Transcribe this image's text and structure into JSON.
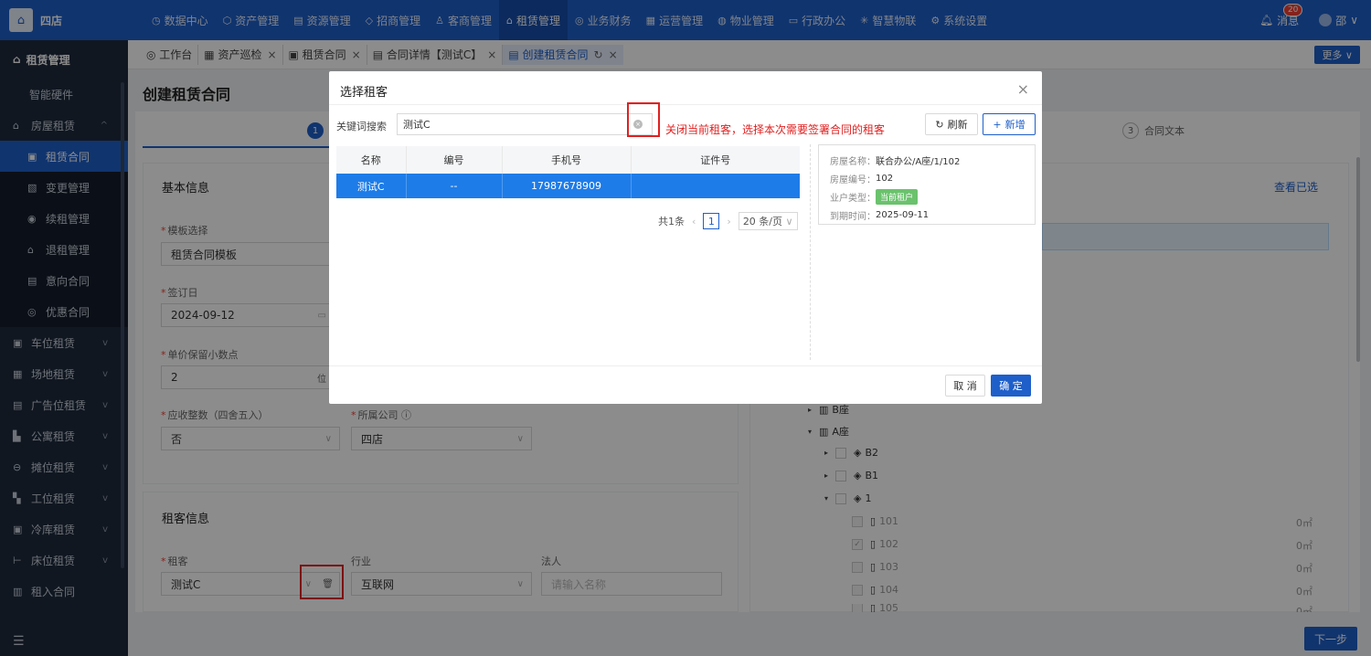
{
  "app": {
    "logo_glyph": "⌂",
    "brand": "四店"
  },
  "nav": [
    {
      "icon": "◷",
      "label": "数据中心"
    },
    {
      "icon": "⬡",
      "label": "资产管理"
    },
    {
      "icon": "▤",
      "label": "资源管理"
    },
    {
      "icon": "◇",
      "label": "招商管理"
    },
    {
      "icon": "♙",
      "label": "客商管理"
    },
    {
      "icon": "⌂",
      "label": "租赁管理"
    },
    {
      "icon": "◎",
      "label": "业务财务"
    },
    {
      "icon": "▦",
      "label": "运营管理"
    },
    {
      "icon": "◍",
      "label": "物业管理"
    },
    {
      "icon": "▭",
      "label": "行政办公"
    },
    {
      "icon": "✳",
      "label": "智慧物联"
    },
    {
      "icon": "⚙",
      "label": "系统设置"
    }
  ],
  "top_right": {
    "msg_label": "消息",
    "msg_count": "20",
    "user_label": "邵"
  },
  "sidebar": {
    "title": "租赁管理",
    "items": [
      {
        "label": "智能硬件",
        "icon": ""
      },
      {
        "label": "房屋租赁",
        "icon": "⌂",
        "chev": "^"
      },
      {
        "label": "租赁合同",
        "icon": "▣"
      },
      {
        "label": "变更管理",
        "icon": "▧"
      },
      {
        "label": "续租管理",
        "icon": "◉"
      },
      {
        "label": "退租管理",
        "icon": "⌂"
      },
      {
        "label": "意向合同",
        "icon": "▤"
      },
      {
        "label": "优惠合同",
        "icon": "◎"
      },
      {
        "label": "车位租赁",
        "icon": "▣",
        "chev": "v"
      },
      {
        "label": "场地租赁",
        "icon": "▦",
        "chev": "v"
      },
      {
        "label": "广告位租赁",
        "icon": "▤",
        "chev": "v"
      },
      {
        "label": "公寓租赁",
        "icon": "▙",
        "chev": "v"
      },
      {
        "label": "摊位租赁",
        "icon": "⊖",
        "chev": "v"
      },
      {
        "label": "工位租赁",
        "icon": "▚",
        "chev": "v"
      },
      {
        "label": "冷库租赁",
        "icon": "▣",
        "chev": "v"
      },
      {
        "label": "床位租赁",
        "icon": "⊢",
        "chev": "v"
      },
      {
        "label": "租入合同",
        "icon": "▥"
      }
    ],
    "foot_icon": "☰"
  },
  "tabs": [
    {
      "label": "◎ 工作台",
      "closable": false
    },
    {
      "label": "▦ 资产巡检",
      "closable": true
    },
    {
      "label": "▣ 租赁合同",
      "closable": true
    },
    {
      "label": "▤ 合同详情【测试C】",
      "closable": true
    },
    {
      "label": "▤ 创建租赁合同",
      "closable": true,
      "active": true
    }
  ],
  "more_label": "更多 ∨",
  "page": {
    "title": "创建租赁合同",
    "step1_num": "1",
    "step3_num": "3",
    "step3_label": "合同文本",
    "basic": {
      "title": "基本信息",
      "template_label": "模板选择",
      "template_value": "租赁合同模板",
      "sign_label": "签订日",
      "sign_value": "2024-09-12",
      "decimal_label": "单价保留小数点",
      "decimal_value": "2",
      "decimal_suffix": "位",
      "round_label": "应收整数（四舍五入）",
      "round_value": "否",
      "company_label": "所属公司 ⓘ",
      "company_value": "四店"
    },
    "tenant": {
      "title": "租客信息",
      "tenant_label": "租客",
      "tenant_value": "测试C",
      "industry_label": "行业",
      "industry_value": "互联网",
      "legal_label": "法人",
      "legal_placeholder": "请输入名称"
    },
    "right": {
      "view_selected": "查看已选",
      "tree": [
        {
          "label": "B座",
          "level": 0,
          "tri": "▸"
        },
        {
          "label": "A座",
          "level": 0,
          "tri": "▾"
        },
        {
          "label": "B2",
          "level": 1,
          "tri": "▸"
        },
        {
          "label": "B1",
          "level": 1,
          "tri": "▸"
        },
        {
          "label": "1",
          "level": 1,
          "tri": "▾"
        },
        {
          "label": "101",
          "level": 2,
          "area": "0㎡"
        },
        {
          "label": "102",
          "level": 2,
          "area": "0㎡",
          "checked": true
        },
        {
          "label": "103",
          "level": 2,
          "area": "0㎡"
        },
        {
          "label": "104",
          "level": 2,
          "area": "0㎡"
        },
        {
          "label": "105",
          "level": 2,
          "area": "0㎡"
        }
      ]
    },
    "next_label": "下一步"
  },
  "modal": {
    "title": "选择租客",
    "kw_label": "关键词搜索",
    "kw_value": "测试C",
    "annotation": "关闭当前租客，选择本次需要签署合同的租客",
    "refresh_label": "刷新",
    "add_label": "新增",
    "table": {
      "headers": [
        "名称",
        "编号",
        "手机号",
        "证件号"
      ],
      "rows": [
        [
          "测试C",
          "--",
          "17987678909",
          ""
        ]
      ]
    },
    "pager": {
      "total": "共1条",
      "page": "1",
      "size": "20 条/页"
    },
    "house": {
      "name_label": "房屋名称：",
      "name_value": "联合办公/A座/1/102",
      "code_label": "房屋编号：",
      "code_value": "102",
      "type_label": "业户类型：",
      "type_value": "当前租户",
      "expire_label": "到期时间：",
      "expire_value": "2025-09-11"
    },
    "cancel_label": "取 消",
    "ok_label": "确 定"
  }
}
